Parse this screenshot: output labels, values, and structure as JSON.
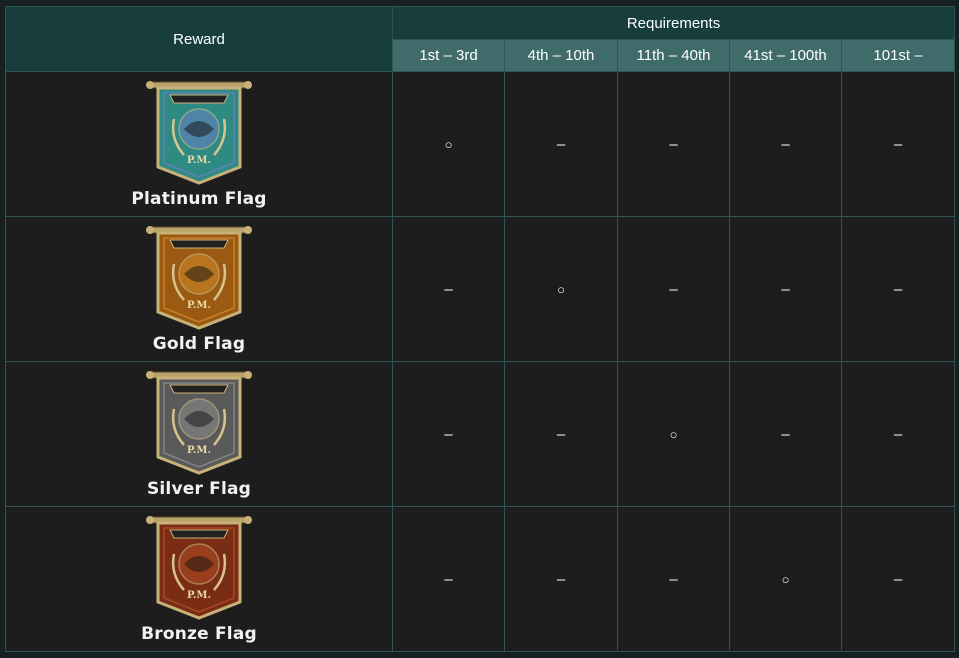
{
  "header": {
    "reward_label": "Reward",
    "requirements_label": "Requirements",
    "ranks": [
      "1st – 3rd",
      "4th – 10th",
      "11th – 40th",
      "41st – 100th",
      "101st –"
    ]
  },
  "rows": [
    {
      "name": "Platinum Flag",
      "emblem_text": "P.M.",
      "color": "#2f8a84",
      "accent": "#6a7fc4",
      "marks": [
        "circle",
        "dash",
        "dash",
        "dash",
        "dash"
      ]
    },
    {
      "name": "Gold Flag",
      "emblem_text": "P.M.",
      "color": "#9a5a12",
      "accent": "#d28a2a",
      "marks": [
        "dash",
        "circle",
        "dash",
        "dash",
        "dash"
      ]
    },
    {
      "name": "Silver Flag",
      "emblem_text": "P.M.",
      "color": "#5a5a5a",
      "accent": "#8e8e8e",
      "marks": [
        "dash",
        "dash",
        "circle",
        "dash",
        "dash"
      ]
    },
    {
      "name": "Bronze Flag",
      "emblem_text": "P.M.",
      "color": "#7a2c14",
      "accent": "#b44f24",
      "marks": [
        "dash",
        "dash",
        "dash",
        "circle",
        "dash"
      ]
    }
  ],
  "symbols": {
    "circle": "○",
    "dash": "–"
  },
  "colors": {
    "header_dark": "#173d3c",
    "header_light": "#3f6c6a",
    "cell_bg": "#1d1d1d",
    "border": "#2c5553"
  }
}
